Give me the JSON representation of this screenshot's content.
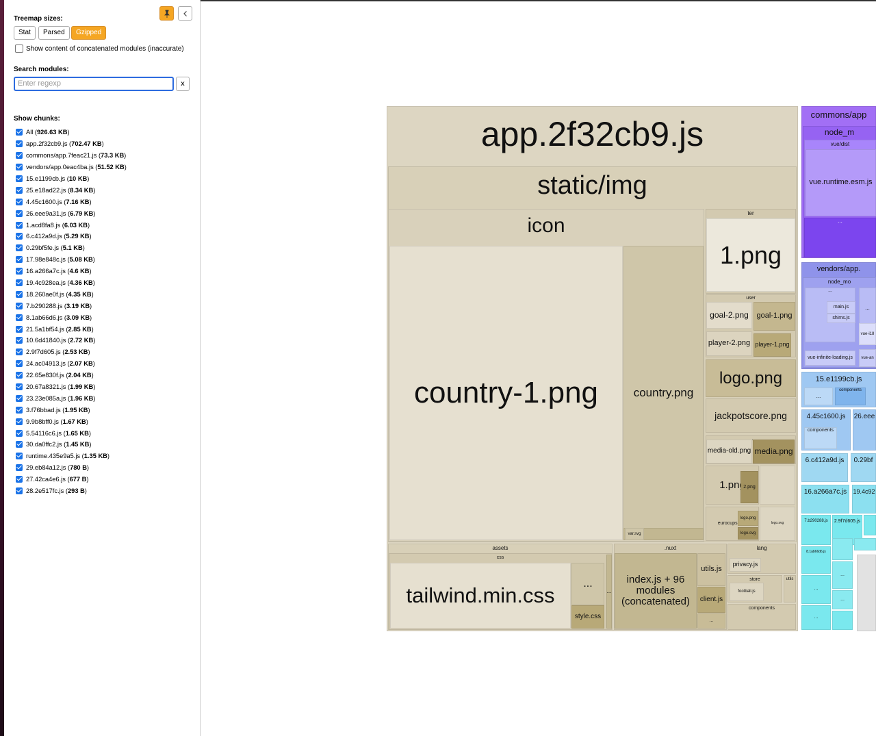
{
  "sidebar": {
    "treemap_sizes_label": "Treemap sizes:",
    "size_buttons": [
      "Stat",
      "Parsed",
      "Gzipped"
    ],
    "active_size": "Gzipped",
    "concatenated_label": "Show content of concatenated modules (inaccurate)",
    "search_label": "Search modules:",
    "search_placeholder": "Enter regexp",
    "clear_label": "x",
    "show_chunks_label": "Show chunks:",
    "chunks": [
      {
        "name": "All",
        "size": "926.63 KB"
      },
      {
        "name": "app.2f32cb9.js",
        "size": "702.47 KB"
      },
      {
        "name": "commons/app.7feac21.js",
        "size": "73.3 KB"
      },
      {
        "name": "vendors/app.0eac4ba.js",
        "size": "51.52 KB"
      },
      {
        "name": "15.e1199cb.js",
        "size": "10 KB"
      },
      {
        "name": "25.e18ad22.js",
        "size": "8.34 KB"
      },
      {
        "name": "4.45c1600.js",
        "size": "7.16 KB"
      },
      {
        "name": "26.eee9a31.js",
        "size": "6.79 KB"
      },
      {
        "name": "1.acd8fa8.js",
        "size": "6.03 KB"
      },
      {
        "name": "6.c412a9d.js",
        "size": "5.29 KB"
      },
      {
        "name": "0.29bf5fe.js",
        "size": "5.1 KB"
      },
      {
        "name": "17.98e848c.js",
        "size": "5.08 KB"
      },
      {
        "name": "16.a266a7c.js",
        "size": "4.6 KB"
      },
      {
        "name": "19.4c928ea.js",
        "size": "4.36 KB"
      },
      {
        "name": "18.260ae0f.js",
        "size": "4.35 KB"
      },
      {
        "name": "7.b290288.js",
        "size": "3.19 KB"
      },
      {
        "name": "8.1ab66d6.js",
        "size": "3.09 KB"
      },
      {
        "name": "21.5a1bf54.js",
        "size": "2.85 KB"
      },
      {
        "name": "10.6d41840.js",
        "size": "2.72 KB"
      },
      {
        "name": "2.9f7d605.js",
        "size": "2.53 KB"
      },
      {
        "name": "24.ac04913.js",
        "size": "2.07 KB"
      },
      {
        "name": "22.65e830f.js",
        "size": "2.04 KB"
      },
      {
        "name": "20.67a8321.js",
        "size": "1.99 KB"
      },
      {
        "name": "23.23e085a.js",
        "size": "1.96 KB"
      },
      {
        "name": "3.f76bbad.js",
        "size": "1.95 KB"
      },
      {
        "name": "9.9b8bff0.js",
        "size": "1.67 KB"
      },
      {
        "name": "5.54116c6.js",
        "size": "1.65 KB"
      },
      {
        "name": "30.da0ffc2.js",
        "size": "1.45 KB"
      },
      {
        "name": "runtime.435e9a5.js",
        "size": "1.35 KB"
      },
      {
        "name": "29.eb84a12.js",
        "size": "780 B"
      },
      {
        "name": "27.42ca4e6.js",
        "size": "677 B"
      },
      {
        "name": "28.2e517fc.js",
        "size": "293 B"
      }
    ]
  },
  "treemap": {
    "colors": {
      "app": "#ddd6c2",
      "app_dark": "#a3925f",
      "commons": "#a26ff5",
      "vendors": "#8f93ea",
      "chunk_blue": "#9fc8f2",
      "chunk_cyan": "#7ae8ee"
    },
    "labels": {
      "app": "app.2f32cb9.js",
      "static_img": "static/img",
      "icon": "icon",
      "country1": "country-1.png",
      "country": "country.png",
      "ter": "ter",
      "one_png": "1.png",
      "user": "user",
      "goal2": "goal-2.png",
      "goal1": "goal-1.png",
      "player2": "player-2.png",
      "player1": "player-1.png",
      "logo": "logo.png",
      "jackpot": "jackpotscore.png",
      "media_old": "media-old.png",
      "media": "media.png",
      "one_png_b": "1.png",
      "two_png": "2.png",
      "eurocups": "eurocups.png",
      "logo_png_s": "logo.png",
      "logo_svg": "logo.svg",
      "var_svg": "var.svg",
      "assets": "assets",
      "css": "css",
      "tailwind": "tailwind.min.css",
      "style": "style.css",
      "nuxt": ".nuxt",
      "index": "index.js + 96 modules (concatenated)",
      "utils": "utils.js",
      "client": "client.js",
      "lang": "lang",
      "privacy": "privacy.js",
      "store": "store",
      "utils_dir": "utils",
      "football": "football.js",
      "components": "components",
      "dots": "...",
      "commons": "commons/app",
      "node_m": "node_m",
      "vue_dist": "vue/dist",
      "vue_runtime": "vue.runtime.esm.js",
      "vendors": "vendors/app.",
      "node_mo": "node_mo",
      "main": "main.js",
      "shims": "shims.js",
      "vue_i18": "vue-i18",
      "vue_inf": "vue-infinite-loading.js",
      "vue_an": "vue-an",
      "c15": "15.e1199cb.js",
      "c4": "4.45c1600.js",
      "c26": "26.eee",
      "c6": "6.c412a9d.js",
      "c0": "0.29bf",
      "c16": "16.a266a7c.js",
      "c19": "19.4c92",
      "c7": "7.b290288.js",
      "c2": "2.9f7d605.js",
      "c8": "8.1ab66d6.js"
    }
  }
}
